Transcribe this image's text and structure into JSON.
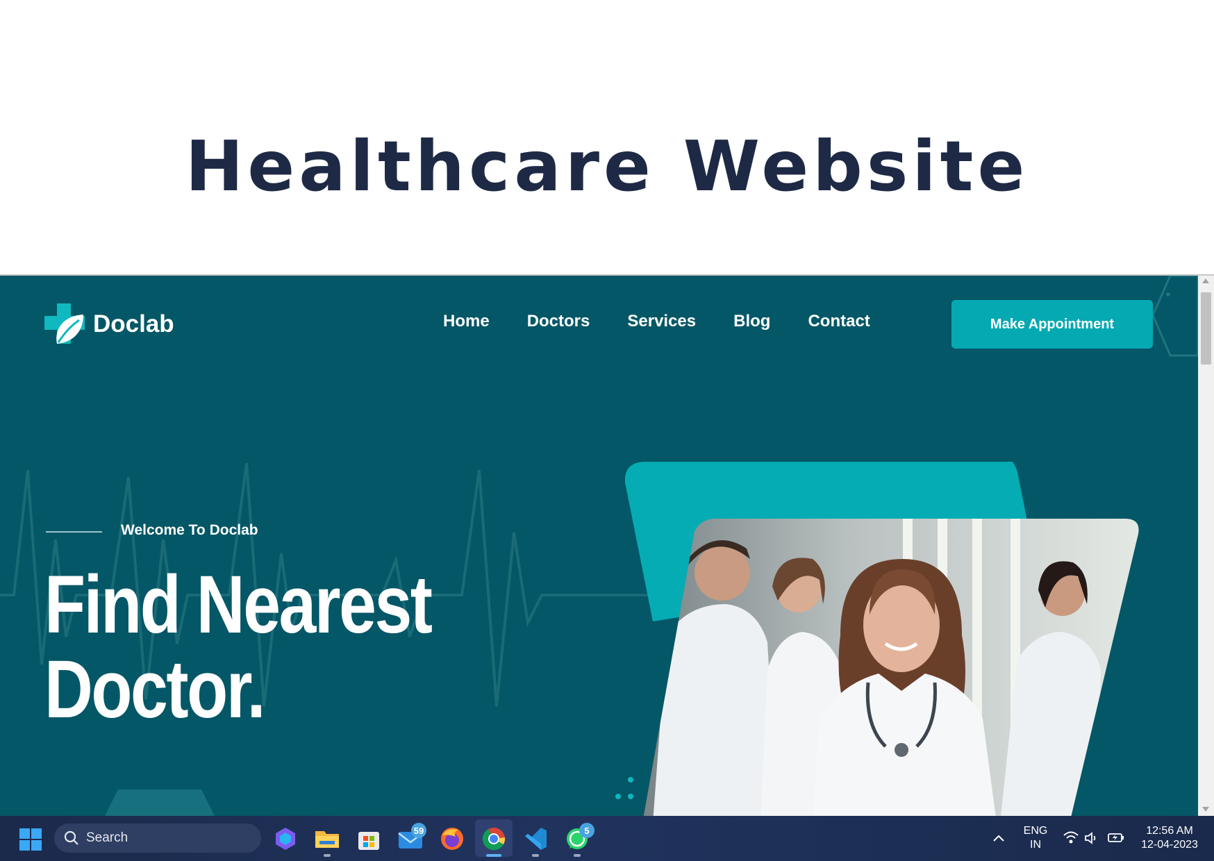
{
  "banner": {
    "title": "Healthcare Website"
  },
  "site": {
    "logo_text": "Doclab",
    "nav": [
      {
        "label": "Home"
      },
      {
        "label": "Doctors"
      },
      {
        "label": "Services"
      },
      {
        "label": "Blog"
      },
      {
        "label": "Contact"
      }
    ],
    "cta_label": "Make Appointment",
    "welcome": "Welcome To Doclab",
    "hero_title_line1": "Find Nearest",
    "hero_title_line2": "Doctor.",
    "colors": {
      "background": "#045766",
      "accent": "#05a9b2",
      "text": "#ffffff"
    }
  },
  "taskbar": {
    "search_placeholder": "Search",
    "mail_badge": "59",
    "whatsapp_badge": "5",
    "lang_line1": "ENG",
    "lang_line2": "IN",
    "time": "12:56 AM",
    "date": "12-04-2023"
  }
}
